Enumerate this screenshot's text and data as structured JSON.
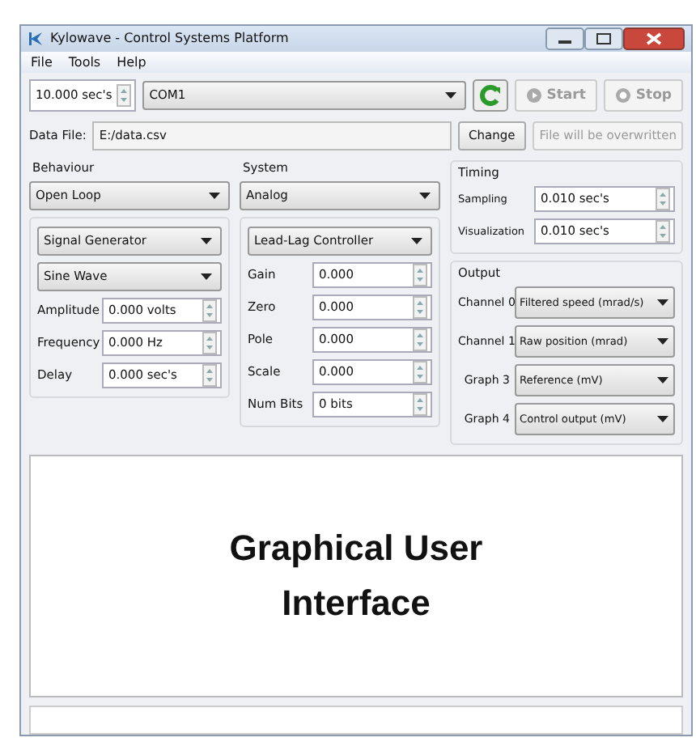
{
  "window": {
    "title": "Kylowave - Control Systems Platform"
  },
  "menu": [
    "File",
    "Tools",
    "Help"
  ],
  "toolbar": {
    "duration": "10.000 sec's",
    "port": "COM1",
    "start": {
      "label": "Start",
      "disabled": true
    },
    "stop": {
      "label": "Stop",
      "disabled": true
    }
  },
  "data_file": {
    "label": "Data File:",
    "value": "E:/data.csv",
    "change": {
      "label": "Change",
      "disabled": false
    },
    "overwrite": {
      "label": "File will be overwritten",
      "disabled": true
    }
  },
  "behaviour": {
    "title": "Behaviour",
    "mode": "Open Loop",
    "source": "Signal Generator",
    "waveform": "Sine Wave",
    "params": [
      {
        "label": "Amplitude",
        "value": "0.000 volts"
      },
      {
        "label": "Frequency",
        "value": "0.000 Hz"
      },
      {
        "label": "Delay",
        "value": "0.000 sec's"
      }
    ]
  },
  "system": {
    "title": "System",
    "type": "Analog",
    "controller": "Lead-Lag Controller",
    "params": [
      {
        "label": "Gain",
        "value": "0.000"
      },
      {
        "label": "Zero",
        "value": "0.000"
      },
      {
        "label": "Pole",
        "value": "0.000"
      },
      {
        "label": "Scale",
        "value": "0.000"
      },
      {
        "label": "Num Bits",
        "value": "0 bits"
      }
    ]
  },
  "timing": {
    "title": "Timing",
    "params": [
      {
        "label": "Sampling",
        "value": "0.010 sec's"
      },
      {
        "label": "Visualization",
        "value": "0.010 sec's"
      }
    ]
  },
  "output": {
    "title": "Output",
    "channels": [
      {
        "label": "Channel 0",
        "value": "Filtered speed (mrad/s)"
      },
      {
        "label": "Channel 1",
        "value": "Raw position (mrad)"
      },
      {
        "label": "Graph 3",
        "value": "Reference (mV)"
      },
      {
        "label": "Graph 4",
        "value": "Control output (mV)"
      }
    ]
  },
  "display": {
    "text": "Graphical User Interface"
  }
}
